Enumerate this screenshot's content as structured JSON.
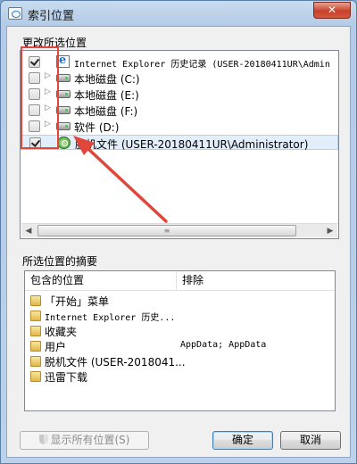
{
  "window": {
    "title": "索引位置",
    "close_glyph": "✕"
  },
  "change_section": {
    "label": "更改所选位置",
    "items": [
      {
        "label": "Internet Explorer 历史记录 (USER-20180411UR\\Admin",
        "checked": true,
        "expander": "",
        "icon": "ie-history-icon",
        "mono": true
      },
      {
        "label": "本地磁盘 (C:)",
        "checked": false,
        "expander": "▷",
        "icon": "disk-icon"
      },
      {
        "label": "本地磁盘 (E:)",
        "checked": false,
        "expander": "▷",
        "icon": "disk-icon"
      },
      {
        "label": "本地磁盘 (F:)",
        "checked": false,
        "expander": "▷",
        "icon": "disk-icon"
      },
      {
        "label": "软件 (D:)",
        "checked": false,
        "expander": "▷",
        "icon": "disk-icon"
      },
      {
        "label": "脱机文件 (USER-20180411UR\\Administrator)",
        "checked": true,
        "expander": "",
        "icon": "offline-files-icon",
        "selected": true
      }
    ]
  },
  "summary_section": {
    "label": "所选位置的摘要",
    "columns": [
      "包含的位置",
      "排除"
    ],
    "rows": [
      {
        "name": "「开始」菜单",
        "exclude": ""
      },
      {
        "name": "Internet Explorer 历史...",
        "exclude": "",
        "mono": true
      },
      {
        "name": "收藏夹",
        "exclude": ""
      },
      {
        "name": "用户",
        "exclude": "AppData; AppData"
      },
      {
        "name": "脱机文件 (USER-2018041...",
        "exclude": ""
      },
      {
        "name": "迅雷下载",
        "exclude": ""
      }
    ]
  },
  "buttons": {
    "show_all": "显示所有位置(S)",
    "ok": "确定",
    "cancel": "取消"
  },
  "colors": {
    "annotation_red": "#e0463a"
  }
}
